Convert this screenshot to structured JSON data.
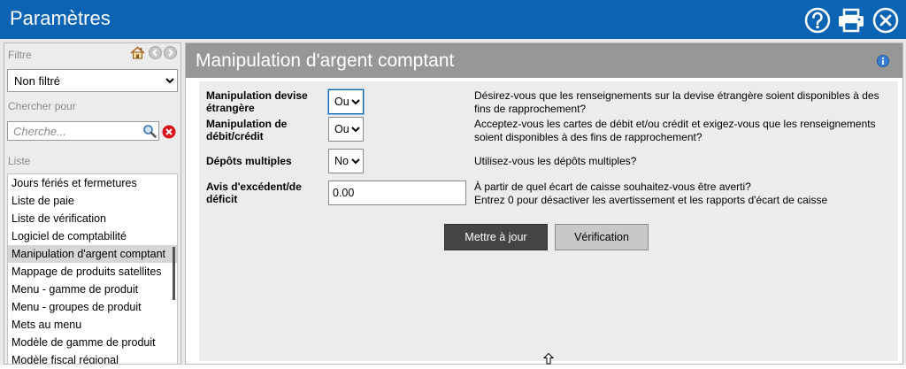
{
  "window": {
    "title": "Paramètres",
    "toolbar_icons": [
      "help-icon",
      "print-icon",
      "close-icon"
    ]
  },
  "sidebar": {
    "filter_label": "Filtre",
    "filter_value": "Non filtré",
    "search_label": "Chercher pour",
    "search_placeholder": "Cherche...",
    "list_label": "Liste",
    "items": [
      "Jours fériés et fermetures",
      "Liste de paie",
      "Liste de vérification",
      "Logiciel de comptabilité",
      "Manipulation d'argent comptant",
      "Mappage de produits satellites",
      "Menu - gamme de produit",
      "Menu - groupes de produit",
      "Mets au menu",
      "Modèle de gamme de produit",
      "Modèle fiscal régional"
    ],
    "selected_index": 4
  },
  "main": {
    "title": "Manipulation d'argent comptant",
    "rows": [
      {
        "label": "Manipulation devise étrangère",
        "value": "Oui",
        "description": "Désirez-vous que les renseignements sur la devise étrangère soient disponibles à des fins de rapprochement?"
      },
      {
        "label": "Manipulation de débit/crédit",
        "value": "Oui",
        "description": "Acceptez-vous les cartes de débit et/ou crédit et exigez-vous que les renseignements soient disponibles à des fins de rapprochement?"
      },
      {
        "label": "Dépôts multiples",
        "value": "Non",
        "description": "Utilisez-vous les dépôts multiples?"
      },
      {
        "label": "Avis d'excédent/de déficit",
        "value": "0.00",
        "description": "À partir de quel écart de caisse souhaitez-vous être averti?",
        "description2": "Entrez 0 pour désactiver les avertissement et les rapports d'écart de caisse"
      }
    ],
    "update_button": "Mettre à jour",
    "verify_button": "Vérification"
  },
  "colors": {
    "titlebar": "#0b63b4",
    "header": "#979797",
    "primary_button": "#444444"
  }
}
